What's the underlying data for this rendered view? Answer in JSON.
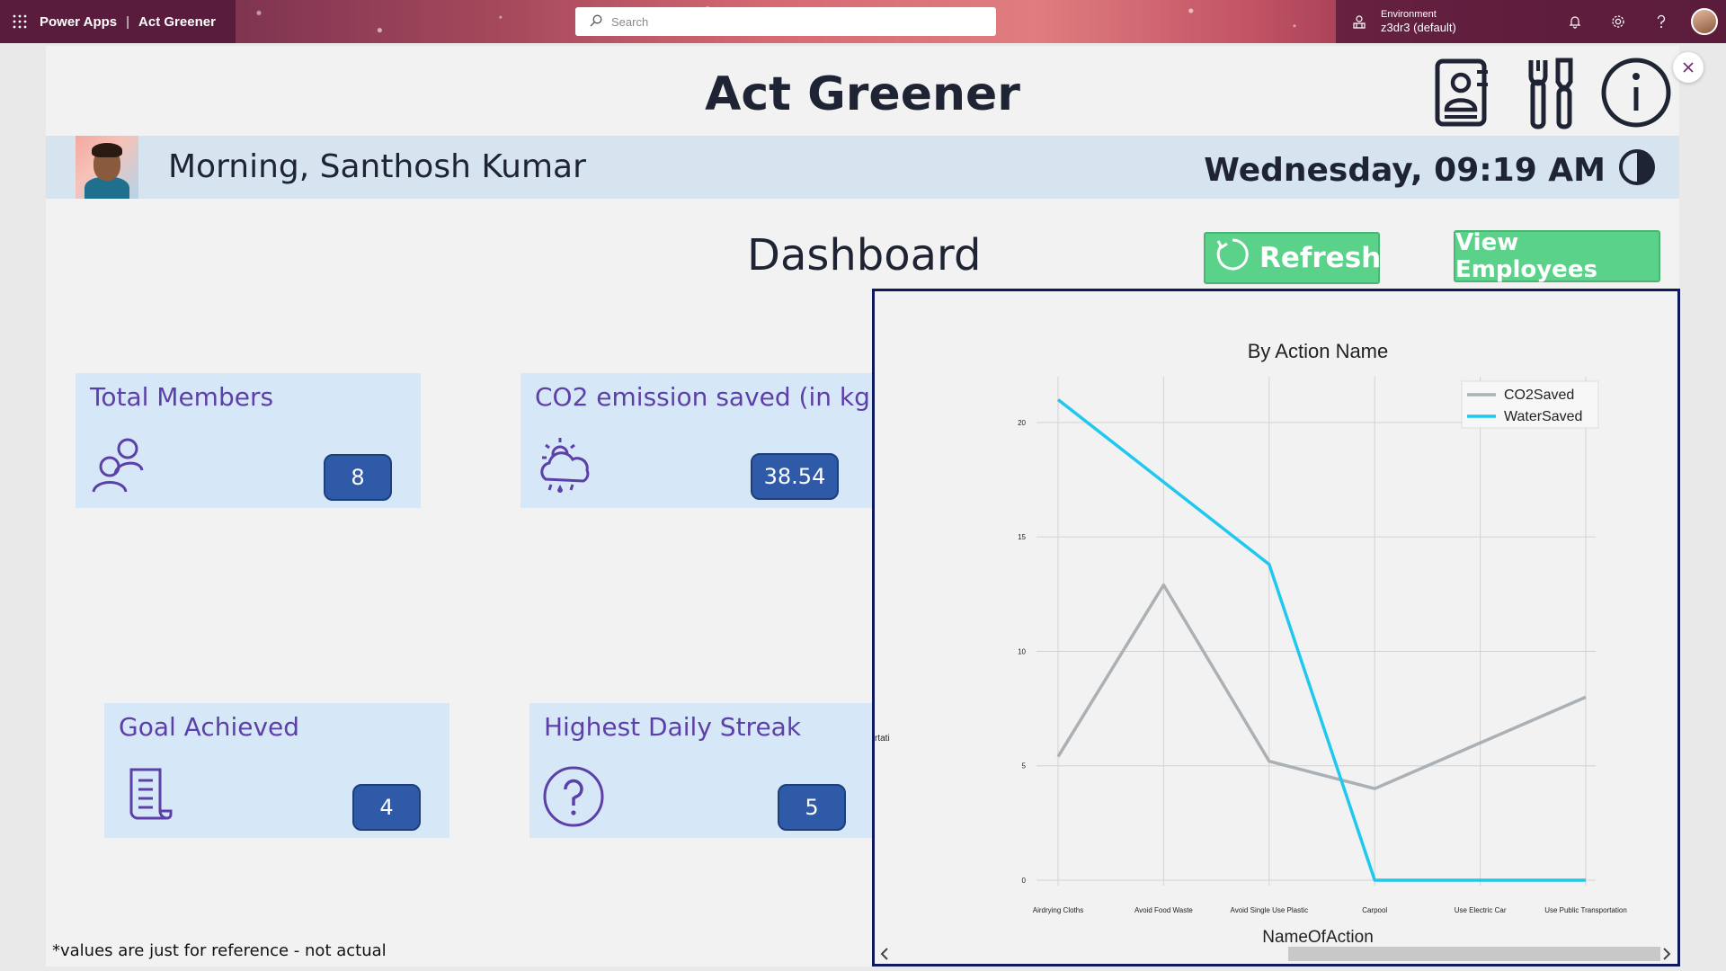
{
  "topbar": {
    "app_name": "Power Apps",
    "separator": "|",
    "app_title": "Act Greener",
    "search_placeholder": "Search",
    "environment_label": "Environment",
    "environment_name": "z3dr3 (default)"
  },
  "header": {
    "title": "Act Greener",
    "icons": [
      "contacts-book-icon",
      "tools-icon",
      "info-icon"
    ]
  },
  "greeting_bar": {
    "greeting": "Morning, Santhosh Kumar",
    "datetime": "Wednesday, 09:19 AM"
  },
  "dashboard": {
    "title": "Dashboard",
    "refresh_label": "Refresh",
    "view_employees_label": "View Employees"
  },
  "cards": {
    "members": {
      "title": "Total Members",
      "value": "8",
      "icon": "people-icon"
    },
    "co2": {
      "title": "CO2 emission saved (in kg)",
      "value": "38.54",
      "icon": "weather-rain-icon"
    },
    "goal": {
      "title": "Goal Achieved",
      "value": "4",
      "icon": "document-icon"
    },
    "streak": {
      "title": "Highest Daily Streak",
      "value": "5",
      "icon": "question-circle-icon"
    }
  },
  "footnote": "*values are just for reference - not actual",
  "chart_clipped_label": "rtati",
  "colors": {
    "brand": "#742774",
    "accent_green": "#5bd28a",
    "card_bg": "#d6e8f7",
    "card_title": "#5d3fa8",
    "badge": "#2e5aa8",
    "co2_series": "#aab0b4",
    "water_series": "#1ec8ef"
  },
  "chart_data": {
    "type": "line",
    "title": "By Action Name",
    "xlabel": "NameOfAction",
    "ylabel": "",
    "categories": [
      "Airdrying Cloths",
      "Avoid Food Waste",
      "Avoid Single Use Plastic",
      "Carpool",
      "Use Electric Car",
      "Use Public Transportation"
    ],
    "series": [
      {
        "name": "CO2Saved",
        "values": [
          5.4,
          12.9,
          5.2,
          4.0,
          6.0,
          8.0
        ]
      },
      {
        "name": "WaterSaved",
        "values": [
          21.0,
          17.4,
          13.8,
          0,
          0,
          0
        ]
      }
    ],
    "yticks": [
      0,
      5,
      10,
      15,
      20
    ],
    "ylim": [
      0,
      22
    ],
    "grid": true,
    "legend": "top-right"
  }
}
